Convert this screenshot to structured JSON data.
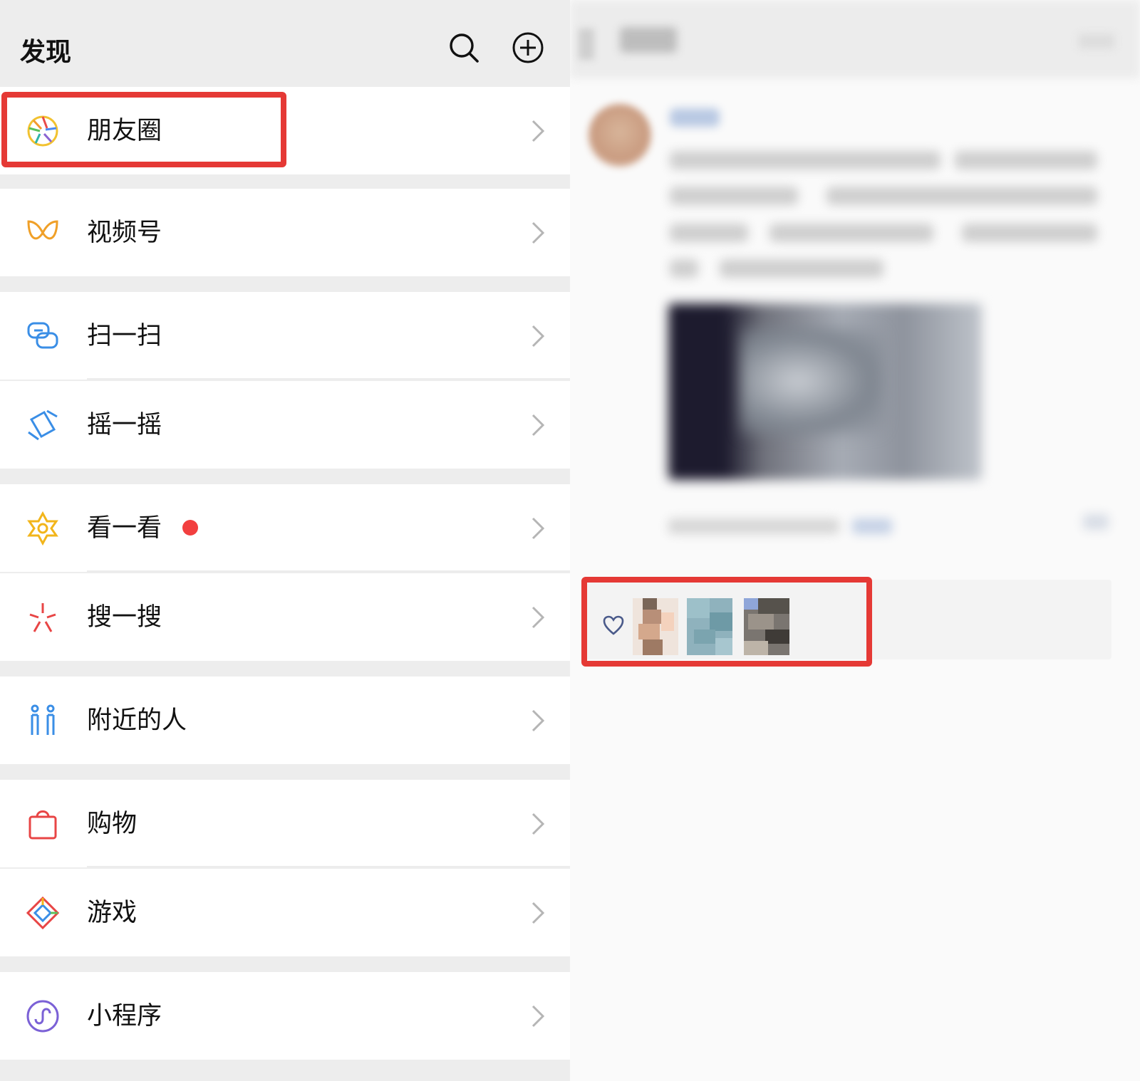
{
  "discover": {
    "title": "发现",
    "header_icons": [
      "search-icon",
      "plus-circle-icon"
    ],
    "items": [
      {
        "label": "朋友圈",
        "icon": "moments-aperture-icon",
        "highlighted": true
      },
      {
        "label": "视频号",
        "icon": "channels-butterfly-icon"
      },
      {
        "label": "扫一扫",
        "icon": "scan-icon"
      },
      {
        "label": "摇一摇",
        "icon": "shake-icon"
      },
      {
        "label": "看一看",
        "icon": "top-stories-icon",
        "badge": "red-dot"
      },
      {
        "label": "搜一搜",
        "icon": "search-sparkle-icon"
      },
      {
        "label": "附近的人",
        "icon": "people-nearby-icon"
      },
      {
        "label": "购物",
        "icon": "shopping-bag-icon"
      },
      {
        "label": "游戏",
        "icon": "games-diamond-icon"
      },
      {
        "label": "小程序",
        "icon": "mini-programs-icon"
      }
    ]
  },
  "moments": {
    "likes": {
      "icon": "heart-icon",
      "liker_avatars": [
        "avatar-1",
        "avatar-2",
        "avatar-3"
      ]
    }
  },
  "colors": {
    "highlight": "#e53935",
    "badge": "#f23f3f",
    "background": "#ededed"
  }
}
